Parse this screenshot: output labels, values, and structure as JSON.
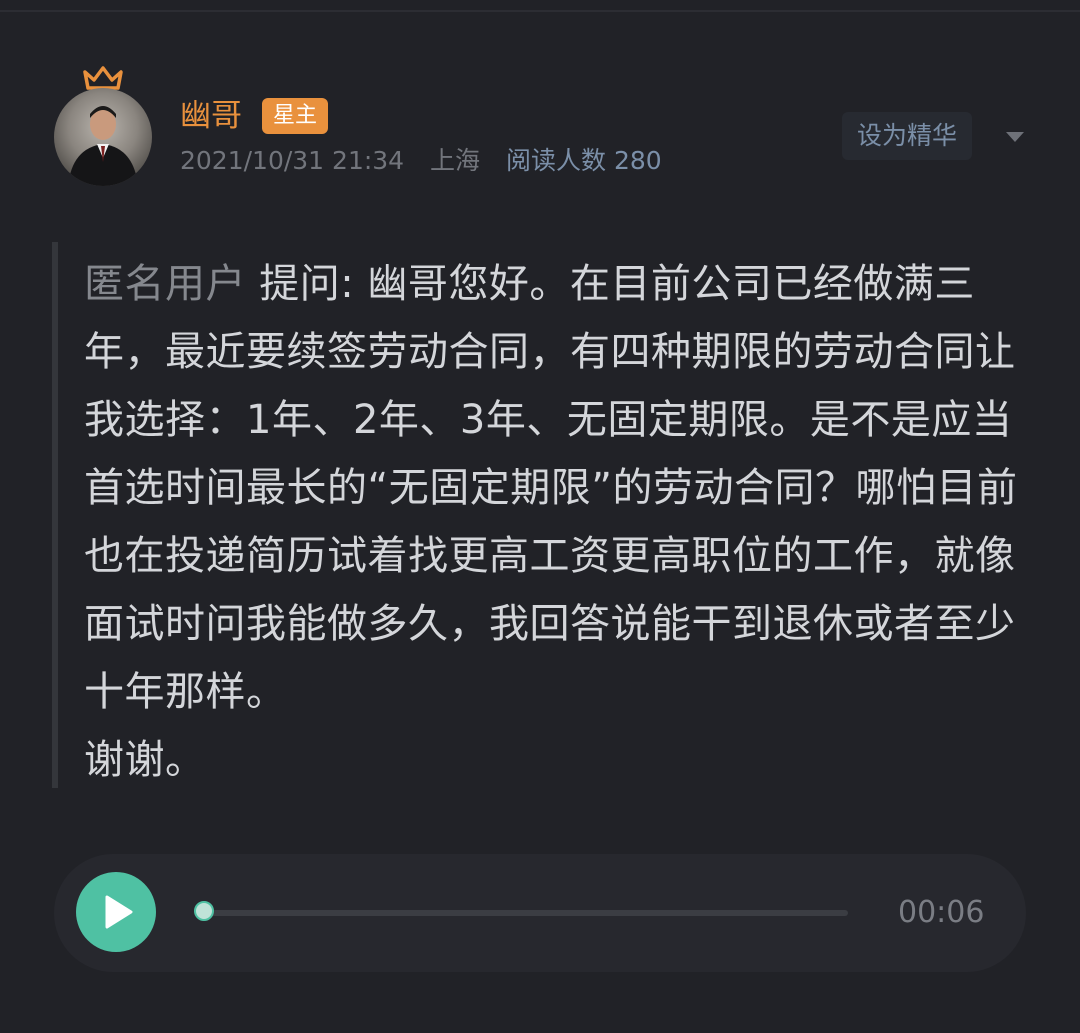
{
  "post": {
    "author": {
      "name": "幽哥",
      "badge": "星主",
      "avatar_icon": "crown-icon"
    },
    "meta": {
      "datetime": "2021/10/31 21:34",
      "location": "上海",
      "reads": "阅读人数 280"
    },
    "actions": {
      "feature_label": "设为精华",
      "more_icon": "chevron-down-icon"
    },
    "question": {
      "asker": "匿名用户",
      "text": "提问: 幽哥您好。在目前公司已经做满三年，最近要续签劳动合同，有四种期限的劳动合同让我选择：1年、2年、3年、无固定期限。是不是应当首选时间最长的“无固定期限”的劳动合同？哪怕目前也在投递简历试着找更高工资更高职位的工作，就像面试时问我能做多久，我回答说能干到退休或者至少十年那样。\n谢谢。"
    },
    "audio": {
      "duration": "00:06",
      "progress": 0
    }
  },
  "colors": {
    "background": "#212227",
    "accent_orange": "#e9913d",
    "accent_green": "#4fc1a3",
    "link_blue": "#7b8fa8"
  }
}
